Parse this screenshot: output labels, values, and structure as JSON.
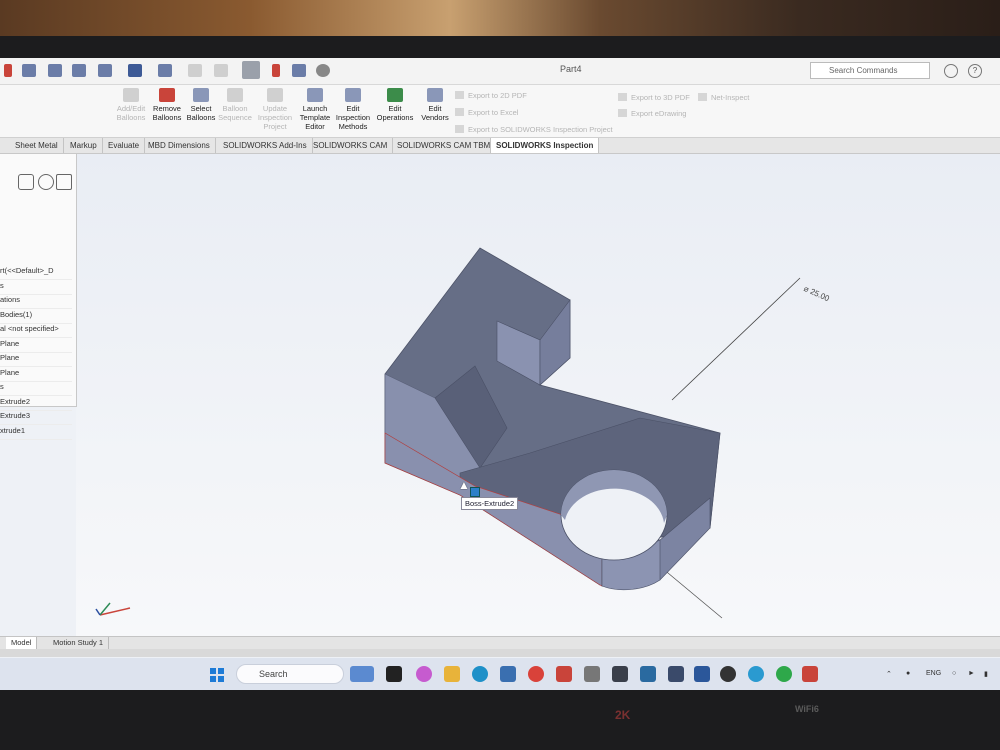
{
  "window": {
    "document_title": "Part4",
    "search_placeholder": "Search Commands",
    "help_label": "?"
  },
  "ribbon": {
    "buttons": [
      {
        "label": "Add/Edit\nBalloons",
        "enabled": false
      },
      {
        "label": "Remove\nBalloons",
        "enabled": true
      },
      {
        "label": "Select\nBalloons",
        "enabled": true
      },
      {
        "label": "Balloon\nSequence",
        "enabled": false
      },
      {
        "label": "Update\nInspection\nProject",
        "enabled": false
      },
      {
        "label": "Launch\nTemplate\nEditor",
        "enabled": true
      },
      {
        "label": "Edit\nInspection\nMethods",
        "enabled": true
      },
      {
        "label": "Edit\nOperations",
        "enabled": true
      },
      {
        "label": "Edit\nVendors",
        "enabled": true
      }
    ],
    "export_2d_pdf": "Export to 2D PDF",
    "export_excel": "Export to Excel",
    "export_project": "Export to SOLIDWORKS Inspection Project",
    "export_3d_pdf": "Export to 3D PDF",
    "export_edrawing": "Export eDrawing",
    "net_inspect": "Net-Inspect"
  },
  "tabs": [
    "Sheet Metal",
    "Markup",
    "Evaluate",
    "MBD Dimensions",
    "SOLIDWORKS Add-Ins",
    "SOLIDWORKS CAM",
    "SOLIDWORKS CAM TBM",
    "SOLIDWORKS Inspection"
  ],
  "active_tab": "SOLIDWORKS Inspection",
  "feature_tree": [
    "rt(<<Default>_D",
    "s",
    "ations",
    "Bodies(1)",
    "al <not specified>",
    "Plane",
    "Plane",
    "Plane",
    "s",
    "Extrude2",
    "Extrude3",
    "xtrude1"
  ],
  "viewport": {
    "dimension_label": "⌀ 25.00",
    "tooltip": "Boss-Extrude2"
  },
  "bottom_tabs": [
    "Model",
    "Motion Study 1"
  ],
  "taskbar": {
    "search_label": "Search",
    "language": "ENG"
  },
  "bezel": {
    "label_2k": "2K",
    "label_wifi": "WiFi6"
  },
  "colors": {
    "part_top": "#626a82",
    "part_side": "#8e96b2",
    "part_front": "#7a829c",
    "accent": "#1e7bd6"
  }
}
